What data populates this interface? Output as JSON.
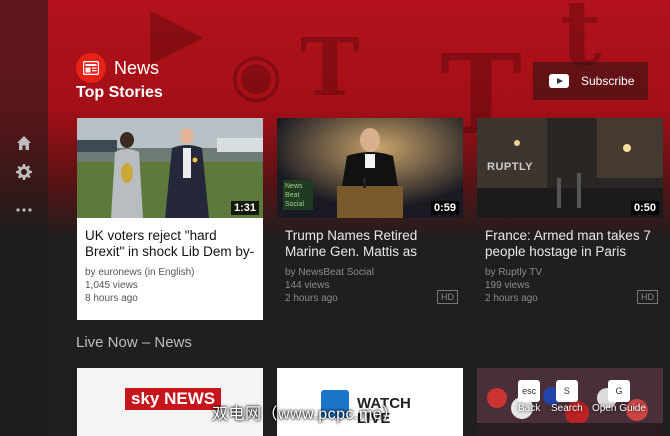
{
  "header": {
    "channel_name": "News",
    "section_title": "Top Stories",
    "subscribe_label": "Subscribe"
  },
  "rail": {
    "items": [
      {
        "icon": "home-icon"
      },
      {
        "icon": "gear-icon"
      },
      {
        "icon": "more-icon"
      }
    ]
  },
  "top_stories": [
    {
      "title": "UK voters reject \"hard Brexit\" in shock Lib Dem by-election",
      "channel": "by euronews (in English)",
      "views": "1,045 views",
      "age": "8 hours ago",
      "duration": "1:31",
      "hd": ""
    },
    {
      "title": "Trump Names Retired Marine Gen. Mattis as",
      "channel": "by NewsBeat Social",
      "views": "144 views",
      "age": "2 hours ago",
      "duration": "0:59",
      "hd": "HD",
      "thumb_overlay": "News Beat Social"
    },
    {
      "title": "France: Armed man takes 7 people hostage in Paris",
      "channel": "by Ruptly TV",
      "views": "199 views",
      "age": "2 hours ago",
      "duration": "0:50",
      "hd": "HD",
      "thumb_overlay": "RUPTLY"
    }
  ],
  "live_section": {
    "title": "Live Now – News",
    "cards": [
      {
        "logo_text": "sky NEWS"
      },
      {
        "logo_text": "WATCH LIVE"
      },
      {
        "logo_text": ""
      }
    ]
  },
  "hints": [
    {
      "key": "esc",
      "label": "Back"
    },
    {
      "key": "S",
      "label": "Search"
    },
    {
      "key": "G",
      "label": "Open Guide"
    }
  ],
  "watermark": "双电网（www.pcpc.me）"
}
